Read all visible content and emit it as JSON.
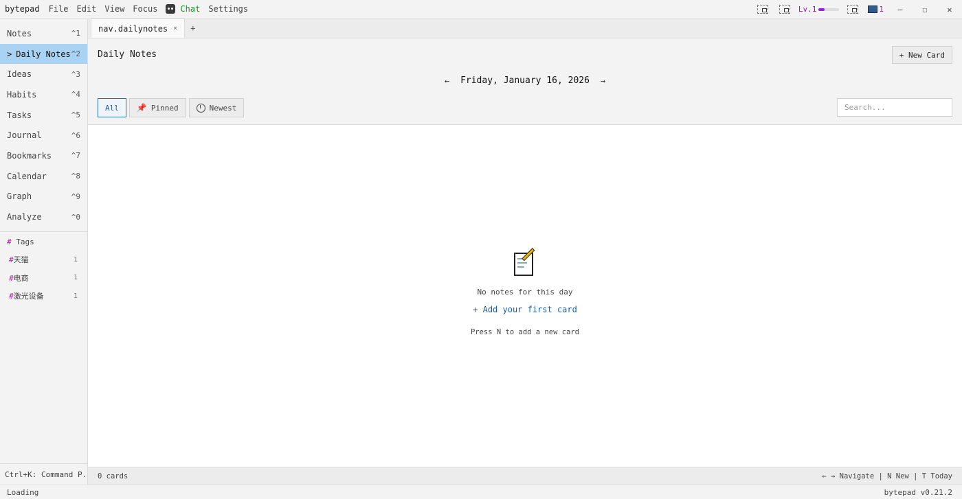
{
  "app": {
    "name": "bytepad",
    "version": "bytepad v0.21.2"
  },
  "menu": {
    "file": "File",
    "edit": "Edit",
    "view": "View",
    "focus": "Focus",
    "chat": "Chat",
    "settings": "Settings"
  },
  "titlebar": {
    "level": "Lv.1",
    "level_progress": 0.3,
    "monitor_count": "1",
    "minimize": "—",
    "maximize": "☐",
    "close": "✕"
  },
  "sidebar": {
    "items": [
      {
        "label": "Notes",
        "shortcut": "^1"
      },
      {
        "label": "Daily Notes",
        "shortcut": "^2",
        "active": true
      },
      {
        "label": "Ideas",
        "shortcut": "^3"
      },
      {
        "label": "Habits",
        "shortcut": "^4"
      },
      {
        "label": "Tasks",
        "shortcut": "^5"
      },
      {
        "label": "Journal",
        "shortcut": "^6"
      },
      {
        "label": "Bookmarks",
        "shortcut": "^7"
      },
      {
        "label": "Calendar",
        "shortcut": "^8"
      },
      {
        "label": "Graph",
        "shortcut": "^9"
      },
      {
        "label": "Analyze",
        "shortcut": "^0"
      }
    ],
    "active_caret": ">",
    "tags_heading": "Tags",
    "tags_hash": "#",
    "tags": [
      {
        "name": "天猫",
        "count": "1"
      },
      {
        "name": "电商",
        "count": "1"
      },
      {
        "name": "激光设备",
        "count": "1"
      }
    ],
    "footer": "Ctrl+K: Command P..."
  },
  "tabs": {
    "active": "nav.dailynotes",
    "close": "×",
    "add": "+"
  },
  "header": {
    "title": "Daily Notes",
    "new_card": "+ New Card",
    "prev_arrow": "←",
    "date": "Friday, January 16, 2026",
    "next_arrow": "→"
  },
  "filters": {
    "all": "All",
    "pinned": "Pinned",
    "newest": "Newest"
  },
  "search": {
    "placeholder": "Search...",
    "value": ""
  },
  "empty": {
    "message": "No notes for this day",
    "add_link": "+ Add your first card",
    "hint": "Press N to add a new card"
  },
  "footer": {
    "count": "0 cards",
    "shortcuts": "← → Navigate | N New | T Today"
  },
  "status": {
    "left": "Loading"
  }
}
